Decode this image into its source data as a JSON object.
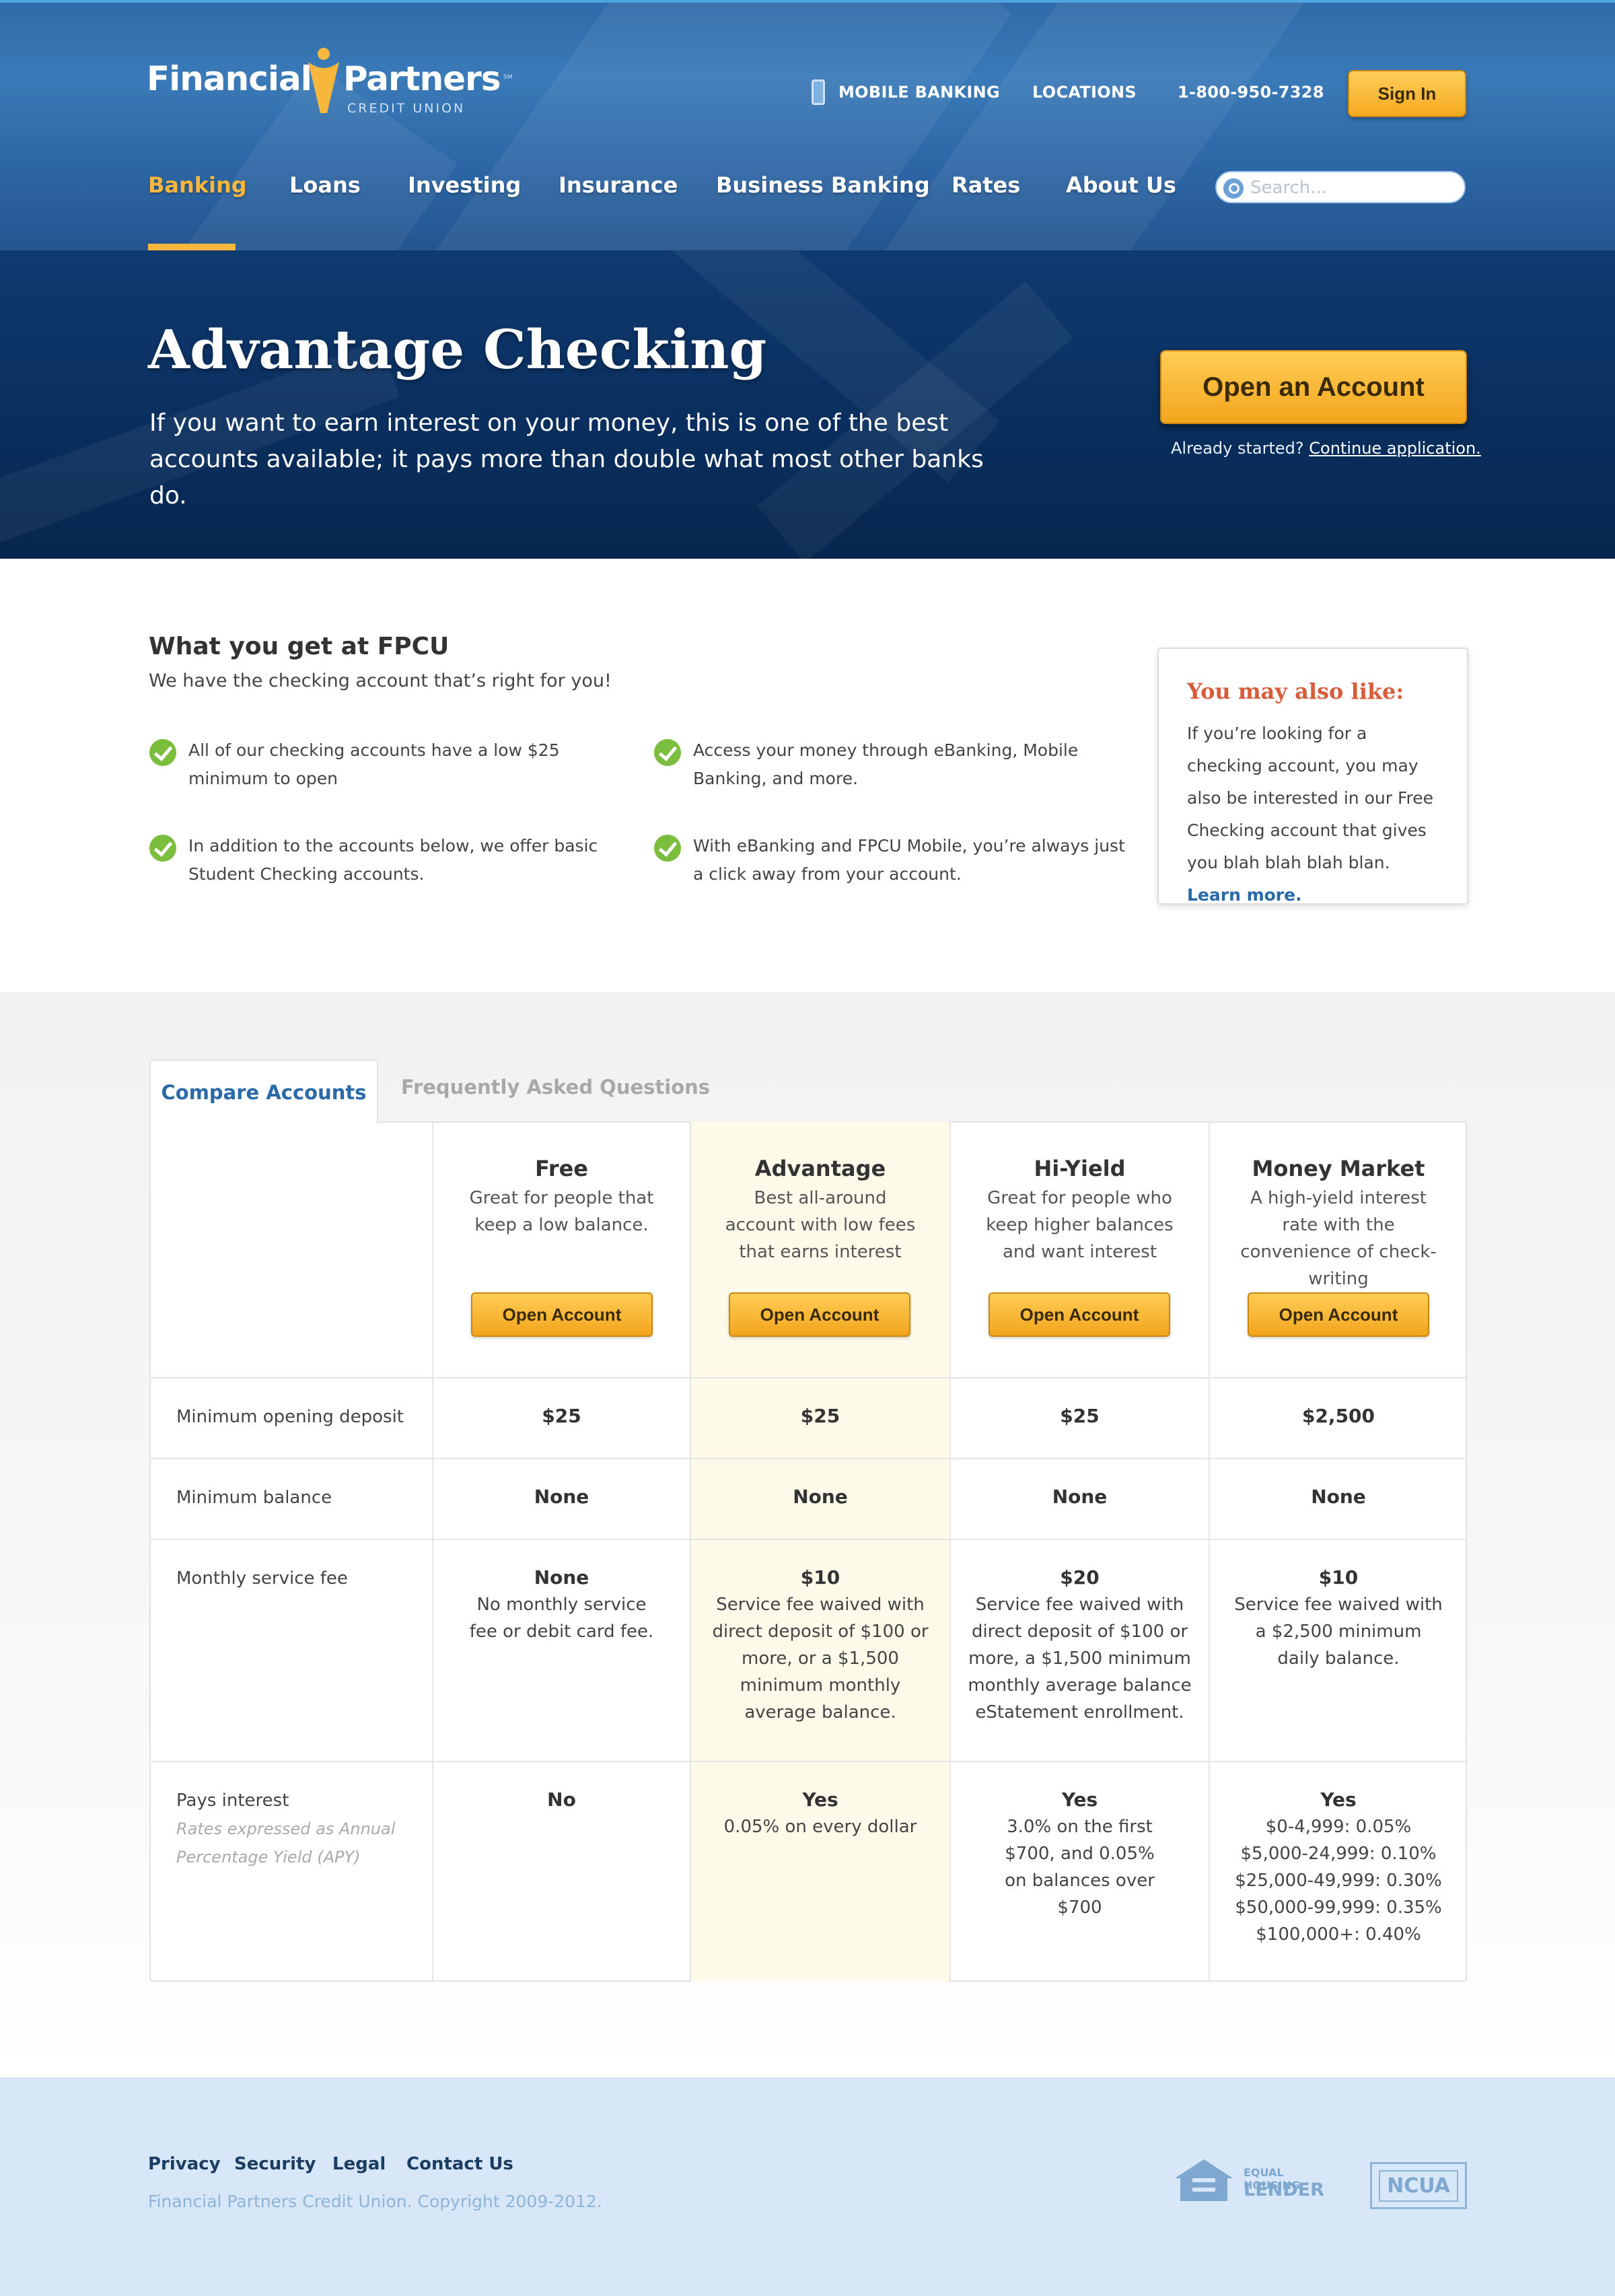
{
  "brand": {
    "name_part1": "Financial",
    "name_part2": "Partners",
    "subtitle": "CREDIT UNION",
    "service_mark": "SM",
    "accent_color": "#f6b73c",
    "primary_color": "#2c64a3"
  },
  "utility_nav": {
    "mobile_banking": "MOBILE BANKING",
    "locations": "LOCATIONS",
    "phone": "1-800-950-7328",
    "sign_in": "Sign In"
  },
  "main_nav": {
    "items": [
      "Banking",
      "Loans",
      "Investing",
      "Insurance",
      "Business Banking",
      "Rates",
      "About Us"
    ],
    "active": "Banking",
    "search_placeholder": "Search..."
  },
  "hero": {
    "title": "Advantage Checking",
    "subtitle": "If you want to earn interest on your money, this is one of the best accounts available; it pays more than double what most other banks do.",
    "cta": "Open an Account",
    "already_started": "Already started?",
    "continue_link": "Continue application."
  },
  "intro": {
    "title": "What you get at FPCU",
    "subtitle": "We have the checking account that’s right for you!",
    "features": [
      "All of our checking accounts have a low $25 minimum to open",
      "Access your money through eBanking, Mobile Banking, and more.",
      "In addition to the accounts below, we offer basic Student Checking accounts.",
      "With eBanking and FPCU Mobile, you’re always just a click away from your account."
    ]
  },
  "promo": {
    "title": "You may also like:",
    "body": "If you’re looking for a checking account, you may also be interested in our Free Checking account that gives you blah blah blah blan.",
    "link": "Learn more."
  },
  "tabs": {
    "compare": "Compare Accounts",
    "faq": "Frequently Asked Questions"
  },
  "compare": {
    "button_label": "Open Account",
    "accounts": [
      {
        "name": "Free",
        "desc": "Great for people that keep a low balance."
      },
      {
        "name": "Advantage",
        "desc": "Best all-around account with low fees that earns interest"
      },
      {
        "name": "Hi-Yield",
        "desc": "Great for people who keep higher balances and want interest"
      },
      {
        "name": "Money Market",
        "desc": "A high-yield interest rate with the convenience of check-writing"
      }
    ],
    "rows": {
      "min_deposit": {
        "label": "Minimum opening deposit",
        "values": [
          "$25",
          "$25",
          "$25",
          "$2,500"
        ]
      },
      "min_balance": {
        "label": "Minimum balance",
        "values": [
          "None",
          "None",
          "None",
          "None"
        ]
      },
      "service_fee": {
        "label": "Monthly service fee",
        "values": [
          "None",
          "$10",
          "$20",
          "$10"
        ],
        "notes": [
          "No monthly service fee or debit card fee.",
          "Service fee waived with direct deposit of $100 or more, or a $1,500 minimum monthly average balance.",
          "Service fee waived with direct deposit of $100 or more, a $1,500 minimum monthly average balance eStatement enrollment.",
          "Service fee waived with a $2,500 minimum daily balance."
        ]
      },
      "interest": {
        "label": "Pays interest",
        "label_note": "Rates expressed as Annual Percentage Yield (APY)",
        "values": [
          "No",
          "Yes",
          "Yes",
          "Yes"
        ],
        "notes": [
          "",
          "0.05% on every dollar",
          "3.0% on the first $700, and 0.05% on balances over $700",
          ""
        ],
        "money_market_tiers": [
          "$0-4,999: 0.05%",
          "$5,000-24,999: 0.10%",
          "$25,000-49,999: 0.30%",
          "$50,000-99,999: 0.35%",
          "$100,000+: 0.40%"
        ]
      }
    }
  },
  "footer": {
    "links": [
      "Privacy",
      "Security",
      "Legal",
      "Contact Us"
    ],
    "copyright": "Financial Partners Credit Union. Copyright 2009-2012.",
    "ehl_line1": "EQUAL HOUSING",
    "ehl_line2": "LENDER",
    "ncua": "NCUA"
  }
}
